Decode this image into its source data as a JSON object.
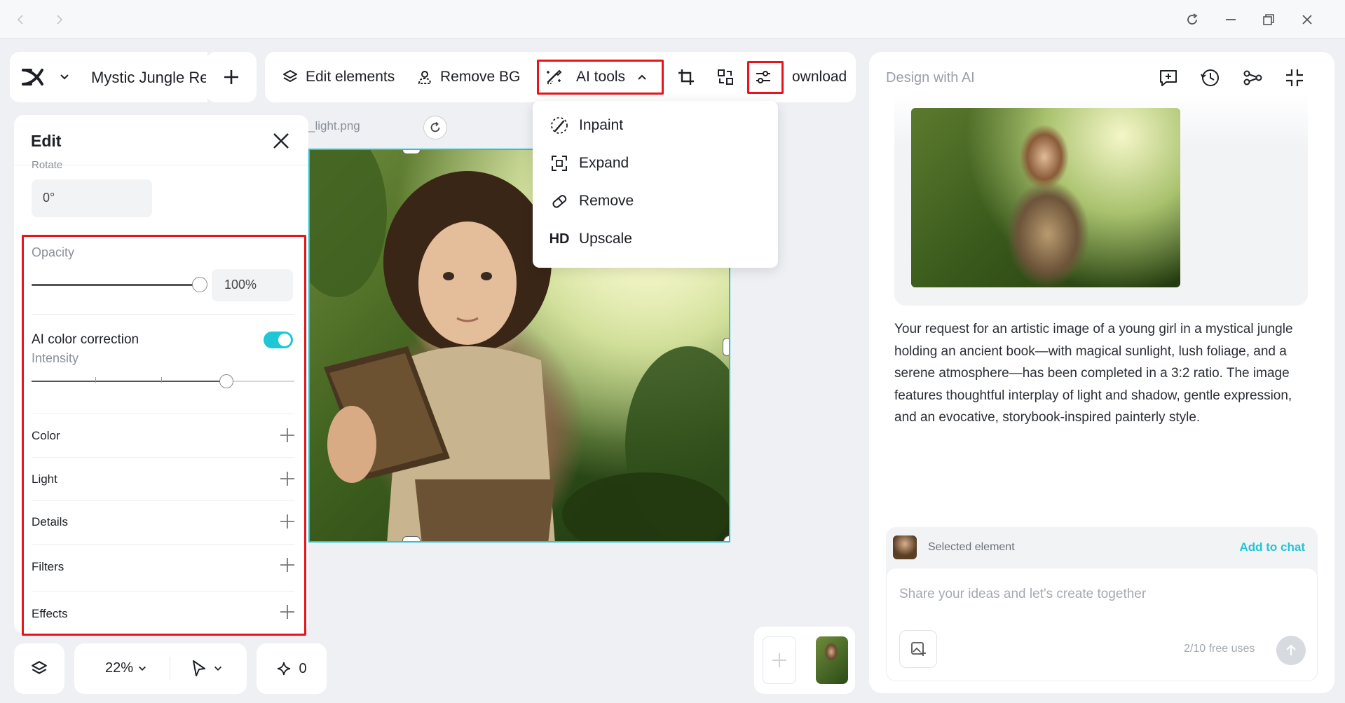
{
  "window": {
    "back_icon": "chevron-left-icon",
    "forward_icon": "chevron-right-icon",
    "reload_icon": "reload-icon",
    "minimize_icon": "minimize-icon",
    "restore_icon": "restore-icon",
    "close_icon": "close-icon"
  },
  "header": {
    "project_title": "Mystic Jungle Re"
  },
  "toolbar": {
    "edit_elements": "Edit elements",
    "remove_bg": "Remove BG",
    "ai_tools": "AI tools",
    "download": "ownload"
  },
  "ai_tools_menu": {
    "items": [
      {
        "label": "Inpaint",
        "icon": "inpaint-brush-icon"
      },
      {
        "label": "Expand",
        "icon": "expand-icon"
      },
      {
        "label": "Remove",
        "icon": "eraser-icon"
      },
      {
        "label": "Upscale",
        "icon": "hd-icon",
        "icon_text": "HD"
      }
    ]
  },
  "canvas": {
    "filename": "_light.png"
  },
  "edit_panel": {
    "title": "Edit",
    "rotate_label": "Rotate",
    "rotate_value": "0°",
    "opacity_label": "Opacity",
    "opacity_value": "100%",
    "opacity_fraction": 1.0,
    "ai_color_label": "AI color correction",
    "ai_color_enabled": true,
    "intensity_label": "Intensity",
    "intensity_fraction": 0.75,
    "rows": [
      "Color",
      "Light",
      "Details",
      "Filters",
      "Effects"
    ]
  },
  "bottom": {
    "zoom": "22%",
    "credits": "0"
  },
  "ai_panel": {
    "title": "Design with AI",
    "response": "Your request for an artistic image of a young girl in a mystical jungle holding an ancient book—with magical sunlight, lush foliage, and a serene atmosphere—has been completed in a 3:2 ratio. The image features thoughtful interplay of light and shadow, gentle expression, and an evocative, storybook-inspired painterly style.",
    "selected_label": "Selected element",
    "add_to_chat": "Add to chat",
    "input_placeholder": "Share your ideas and let's create together",
    "free_uses": "2/10 free uses"
  },
  "colors": {
    "accent": "#1fc6d6",
    "highlight": "#e8141b"
  }
}
